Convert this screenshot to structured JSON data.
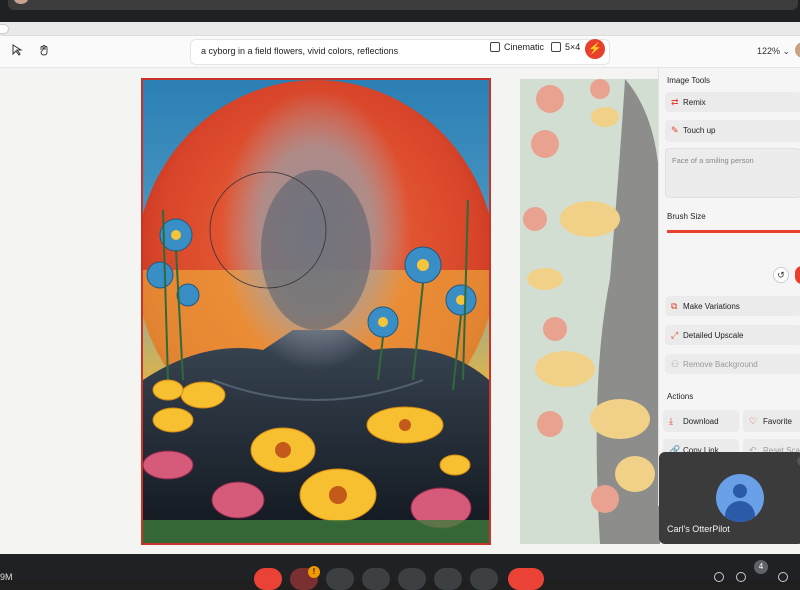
{
  "toolbar": {
    "prompt": "a cyborg in a field flowers, vivid colors, reflections",
    "style_chip": "Cinematic",
    "aspect_chip": "5×4",
    "zoom": "122%"
  },
  "panel": {
    "section_image_tools": "Image Tools",
    "remix": "Remix",
    "touch_up": "Touch up",
    "touch_up_placeholder": "Face of a smiling person",
    "brush_size": "Brush Size",
    "make_variations": "Make Variations",
    "detailed_upscale": "Detailed Upscale",
    "remove_background": "Remove Background",
    "section_actions": "Actions",
    "download": "Download",
    "favorite": "Favorite",
    "copy_link": "Copy Link",
    "reset_scale": "Reset Scale"
  },
  "meeting": {
    "participant_name": "Carl's OtterPilot",
    "notification_badge": "!",
    "participant_count": "4",
    "bottom_left_text": "9M"
  },
  "colors": {
    "accent": "#e8402a",
    "selection_border": "#c8342a"
  }
}
